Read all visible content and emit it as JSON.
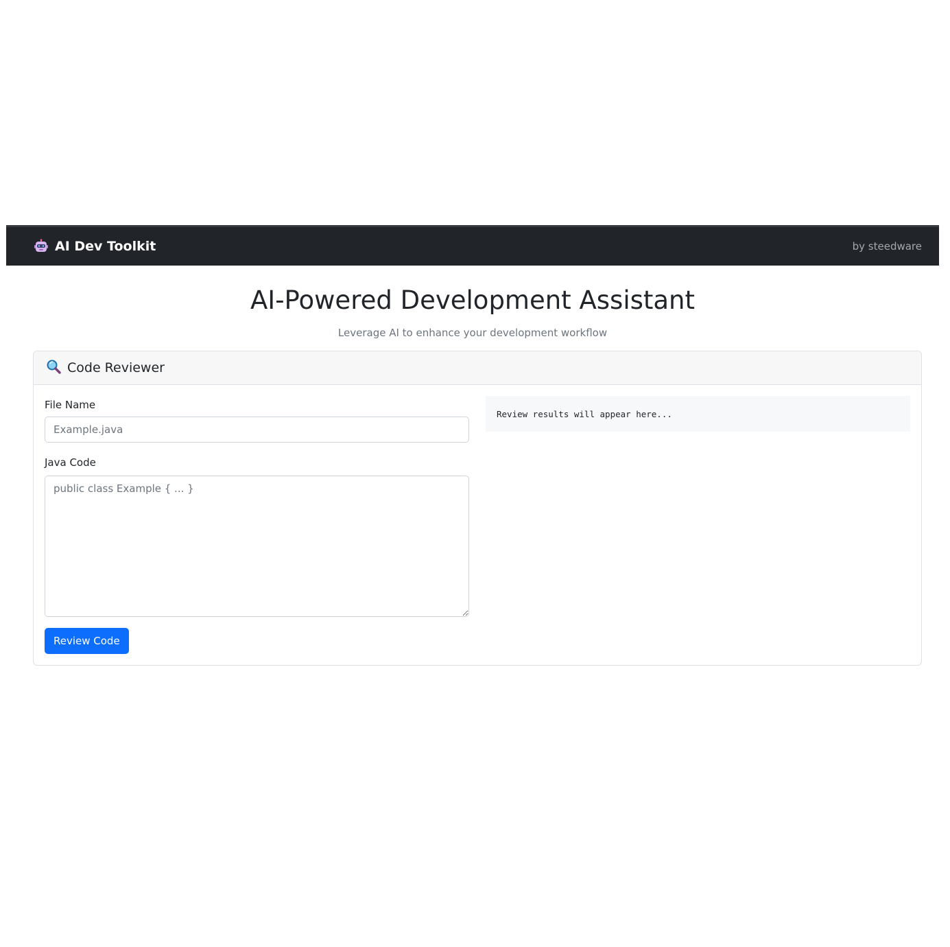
{
  "navbar": {
    "brand_icon": "robot-icon",
    "brand": "AI Dev Toolkit",
    "byline": "by steedware"
  },
  "hero": {
    "title": "AI-Powered Development Assistant",
    "subtitle": "Leverage AI to enhance your development workflow"
  },
  "reviewer": {
    "icon": "magnifying-glass-icon",
    "title": "Code Reviewer",
    "file_label": "File Name",
    "file_placeholder": "Example.java",
    "file_value": "",
    "code_label": "Java Code",
    "code_placeholder": "public class Example { ... }",
    "code_value": "",
    "button_label": "Review Code",
    "result_text": "Review results will appear here..."
  },
  "colors": {
    "navbar_bg": "#212529",
    "primary": "#0d6efd"
  }
}
